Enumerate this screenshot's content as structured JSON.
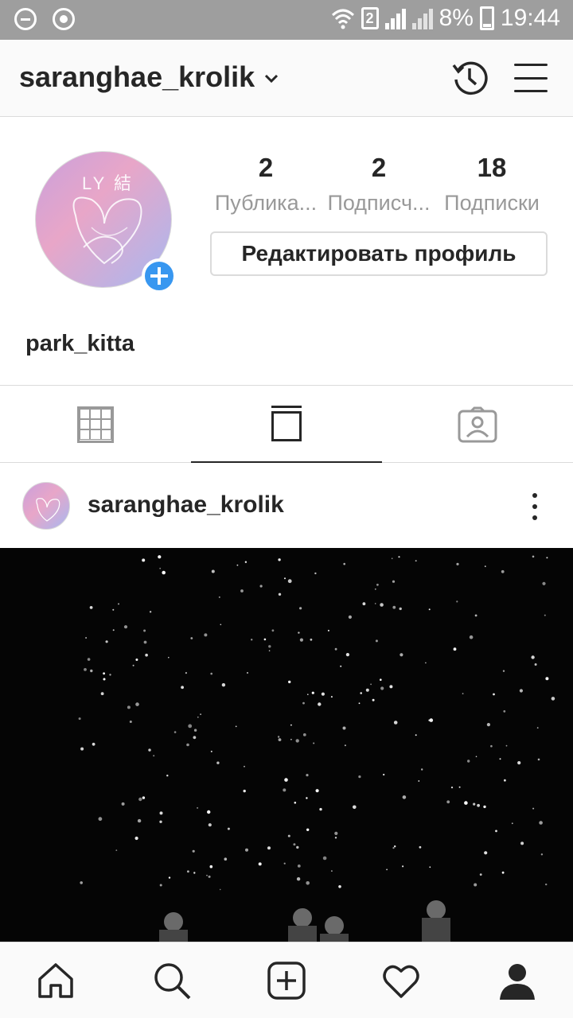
{
  "status_bar": {
    "sim": "2",
    "battery": "8%",
    "time": "19:44"
  },
  "header": {
    "username": "saranghae_krolik",
    "dropdown_icon": "chevron-down-icon",
    "history_icon": "history-icon",
    "menu_icon": "menu-icon"
  },
  "profile": {
    "avatar_text": "LY 結",
    "add_icon": "plus-icon",
    "stats": [
      {
        "value": "2",
        "label": "Публика..."
      },
      {
        "value": "2",
        "label": "Подписч..."
      },
      {
        "value": "18",
        "label": "Подписки"
      }
    ],
    "edit_button": "Редактировать профиль",
    "name": "park_kitta"
  },
  "tabs": [
    {
      "icon": "grid-icon",
      "active": false
    },
    {
      "icon": "feed-icon",
      "active": true
    },
    {
      "icon": "tagged-icon",
      "active": false
    }
  ],
  "post": {
    "username": "saranghae_krolik",
    "more_icon": "more-vertical-icon"
  },
  "bottom_nav": [
    {
      "icon": "home-icon"
    },
    {
      "icon": "search-icon"
    },
    {
      "icon": "add-post-icon"
    },
    {
      "icon": "heart-icon"
    },
    {
      "icon": "profile-icon"
    }
  ],
  "colors": {
    "accent": "#3897f0",
    "text": "#262626",
    "muted": "#999999",
    "border": "#dbdbdb",
    "status_bar": "#9e9e9e"
  }
}
